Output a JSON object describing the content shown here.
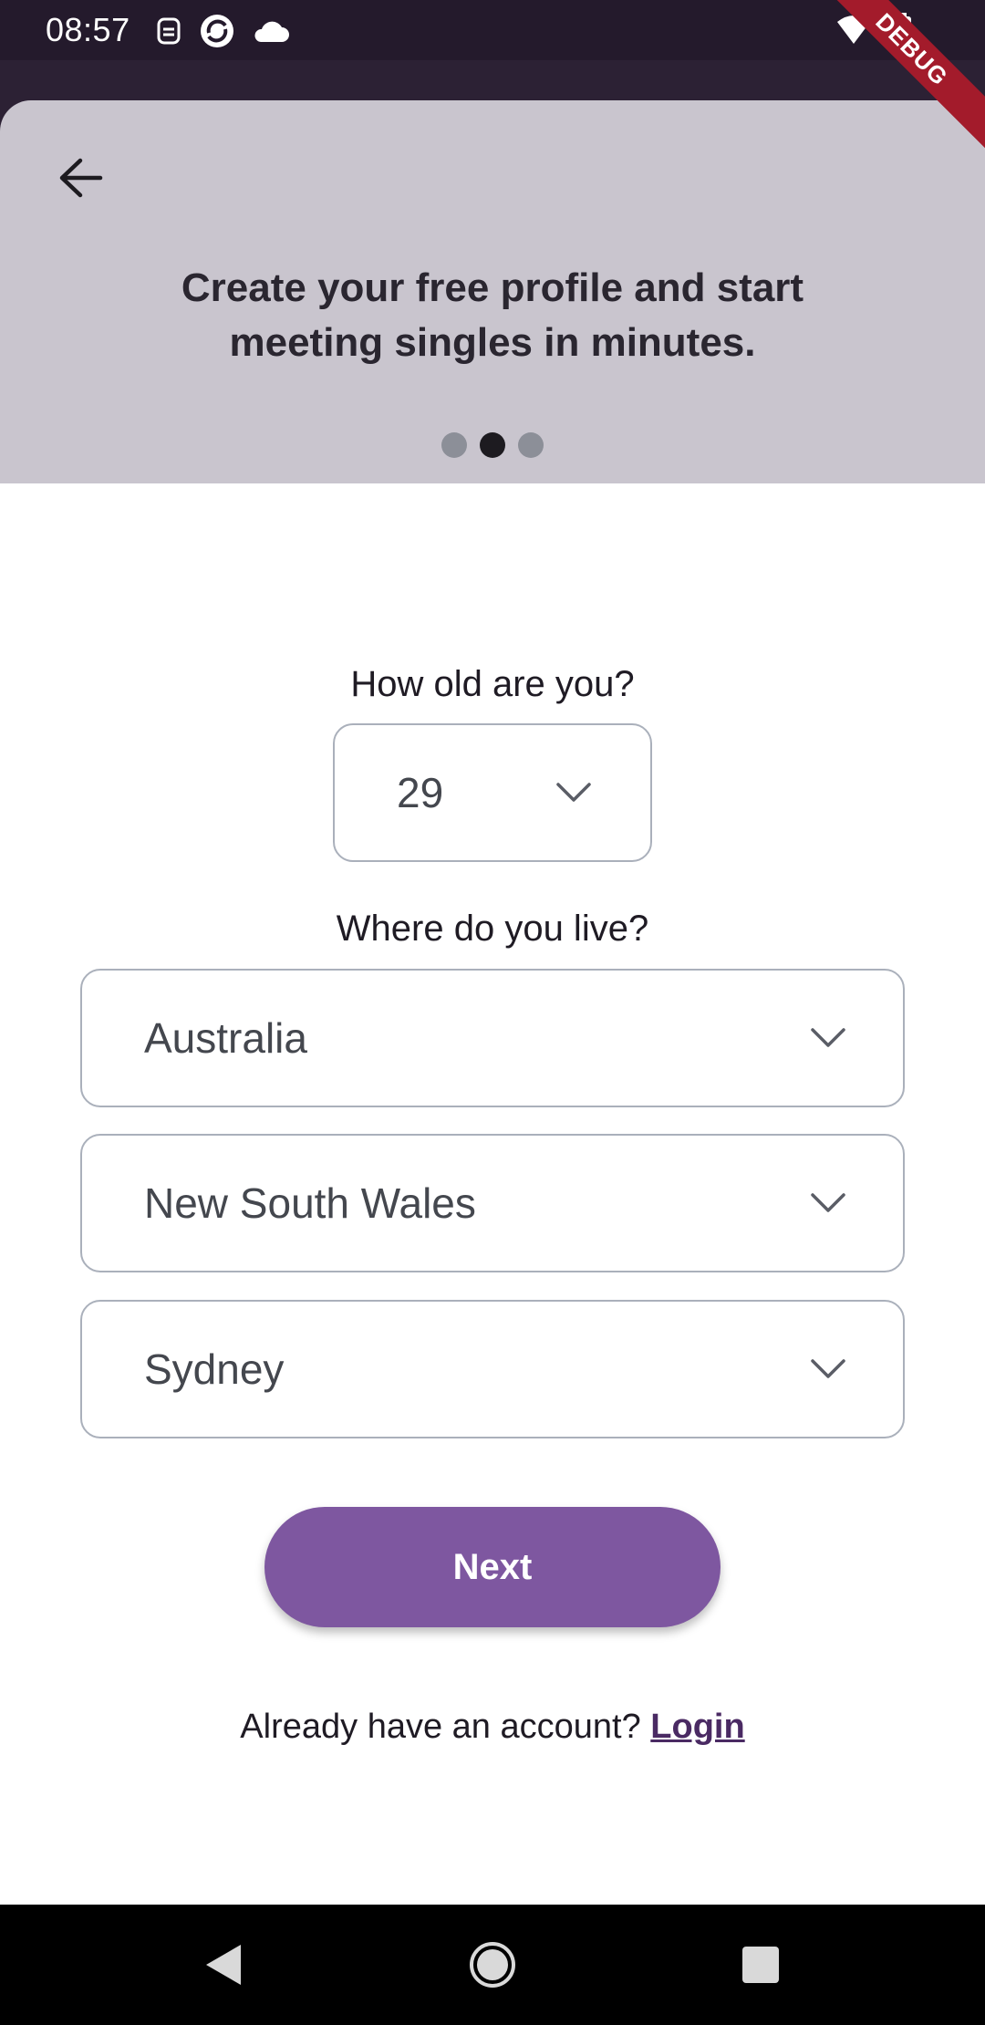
{
  "status_bar": {
    "time": "08:57"
  },
  "header": {
    "headline": "Create your free profile and start meeting singles in minutes.",
    "page_index": 2,
    "page_count": 3
  },
  "debug_banner": "DEBUG",
  "form": {
    "age_label": "How old are you?",
    "age_value": "29",
    "location_label": "Where do you live?",
    "country_value": "Australia",
    "state_value": "New South Wales",
    "city_value": "Sydney",
    "next_label": "Next"
  },
  "login": {
    "prompt": "Already have an account?",
    "link": "Login"
  },
  "colors": {
    "primary": "#7e57a0",
    "header_bg": "#c9c5ce",
    "status_bar_bg": "#241a2c"
  },
  "icons": {
    "back": "arrow-left-icon",
    "chevron": "chevron-down-icon"
  }
}
